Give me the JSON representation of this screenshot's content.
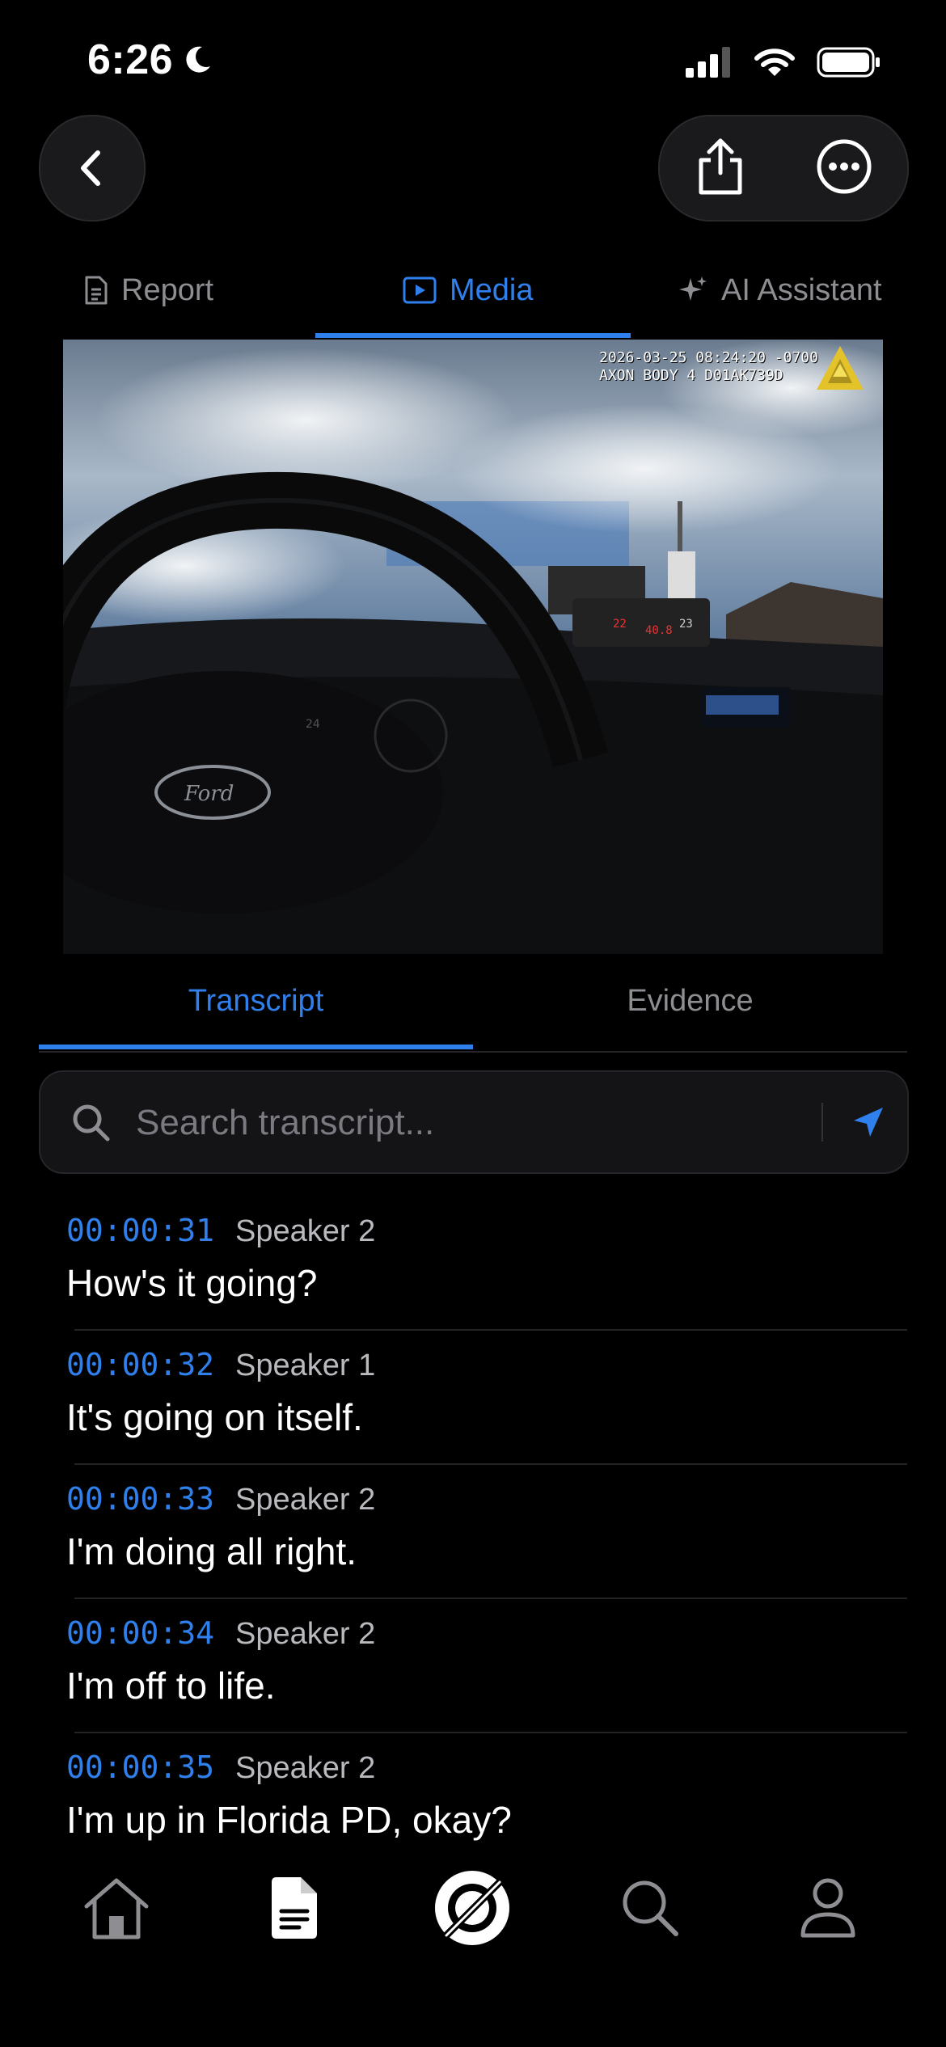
{
  "status": {
    "time": "6:26"
  },
  "top_tabs": [
    {
      "label": "Report"
    },
    {
      "label": "Media"
    },
    {
      "label": "AI Assistant"
    }
  ],
  "video": {
    "overlay_line1": "2026-03-25 08:24:20 -0700",
    "overlay_line2": "AXON BODY 4 D01AK739D"
  },
  "sub_tabs": [
    {
      "label": "Transcript"
    },
    {
      "label": "Evidence"
    }
  ],
  "search": {
    "placeholder": "Search transcript..."
  },
  "transcript": [
    {
      "time": "00:00:31",
      "speaker": "Speaker 2",
      "text": "How's it going?"
    },
    {
      "time": "00:00:32",
      "speaker": "Speaker 1",
      "text": "It's going on itself."
    },
    {
      "time": "00:00:33",
      "speaker": "Speaker 2",
      "text": "I'm doing all right."
    },
    {
      "time": "00:00:34",
      "speaker": "Speaker 2",
      "text": "I'm off to life."
    },
    {
      "time": "00:00:35",
      "speaker": "Speaker 2",
      "text": "I'm up in Florida PD, okay?"
    }
  ],
  "colors": {
    "accent": "#2f80ed",
    "background": "#000000",
    "muted": "#8d8d92"
  },
  "icons": [
    "back-icon",
    "share-icon",
    "more-icon",
    "report-icon",
    "media-icon",
    "sparkle-icon",
    "search-icon",
    "send-icon",
    "home-icon",
    "document-icon",
    "record-icon",
    "search-nav-icon",
    "profile-icon"
  ]
}
